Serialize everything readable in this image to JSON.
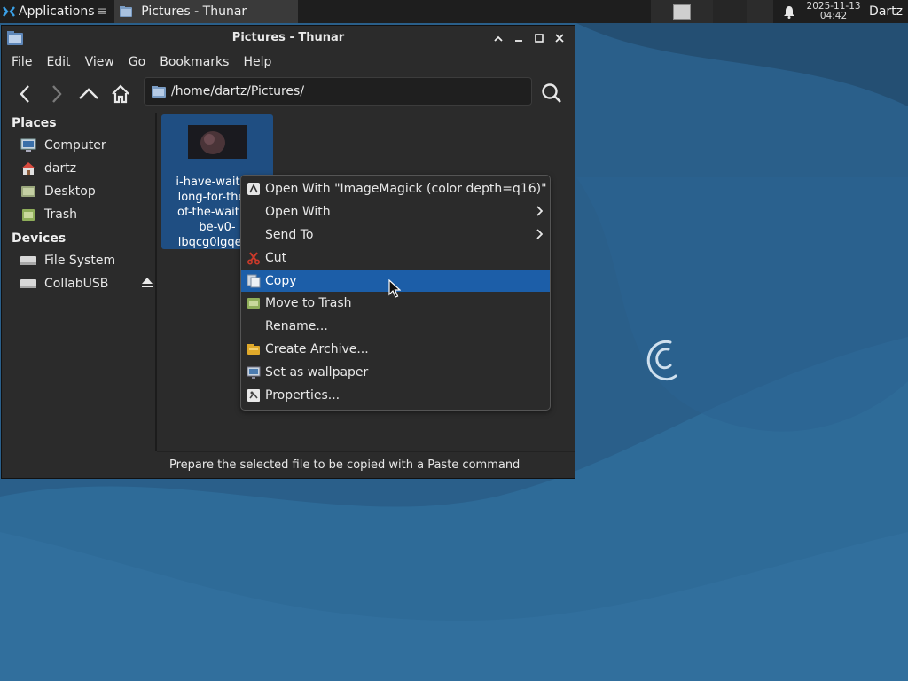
{
  "panel": {
    "applications_label": "Applications",
    "task_label": "Pictures - Thunar",
    "clock_date": "2025-11-13",
    "clock_time": "04:42",
    "user": "Dartz"
  },
  "window": {
    "title": "Pictures - Thunar",
    "menu": [
      "File",
      "Edit",
      "View",
      "Go",
      "Bookmarks",
      "Help"
    ],
    "location": "/home/dartz/Pictures/"
  },
  "sidebar": {
    "places_heading": "Places",
    "places": [
      "Computer",
      "dartz",
      "Desktop",
      "Trash"
    ],
    "devices_heading": "Devices",
    "devices": [
      "File System",
      "CollabUSB"
    ]
  },
  "file": {
    "name_lines": [
      "i-have-waited-",
      "long-for-the-d",
      "of-the-waiting",
      "be-v0-",
      "lbqcg0lgqe0g"
    ]
  },
  "context_menu": {
    "items": [
      {
        "label": "Open With \"ImageMagick (color depth=q16)\"",
        "icon": "imagemagick-icon"
      },
      {
        "label": "Open With",
        "submenu": true
      },
      {
        "label": "Send To",
        "submenu": true
      },
      {
        "label": "Cut",
        "icon": "scissors-icon"
      },
      {
        "label": "Copy",
        "icon": "copy-icon",
        "active": true
      },
      {
        "label": "Move to Trash",
        "icon": "trash-icon"
      },
      {
        "label": "Rename..."
      },
      {
        "label": "Create Archive...",
        "icon": "archive-icon"
      },
      {
        "label": "Set as wallpaper",
        "icon": "wallpaper-icon"
      },
      {
        "label": "Properties...",
        "icon": "properties-icon"
      }
    ]
  },
  "statusbar": {
    "text": "Prepare the selected file to be copied with a Paste command"
  },
  "colors": {
    "selection": "#1c5ea8",
    "desktop": "#2a5f8a"
  }
}
